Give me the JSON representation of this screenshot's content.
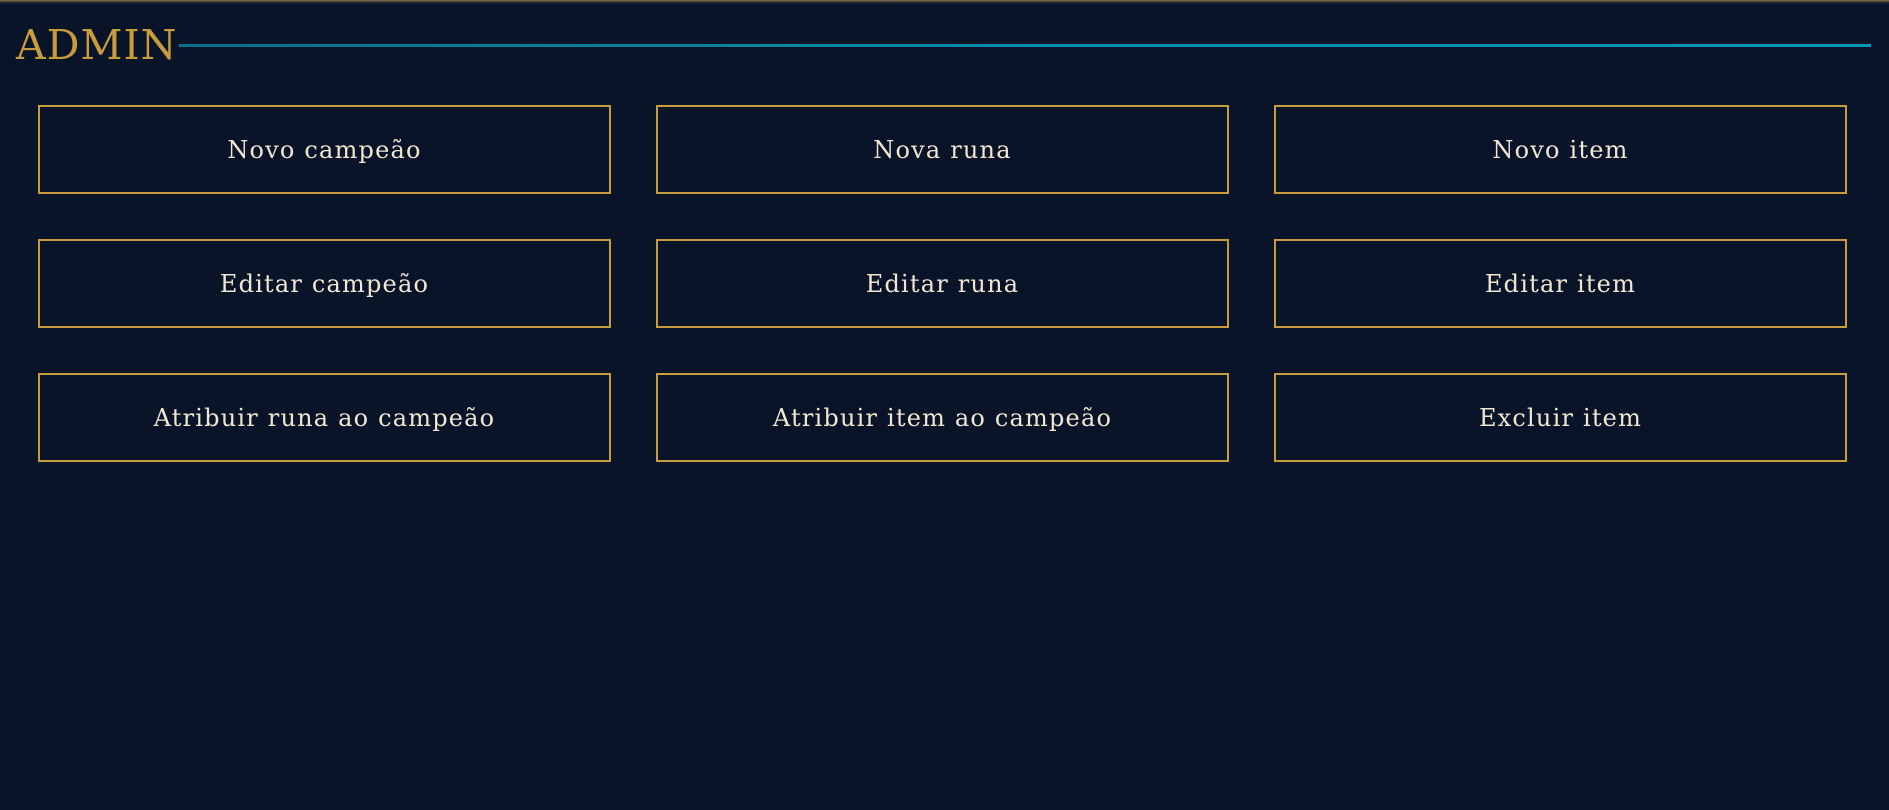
{
  "header": {
    "title": "ADMIN"
  },
  "colors": {
    "background": "#091428",
    "accent_gold": "#c89b3c",
    "rule_teal": "#0a8dab",
    "button_text": "#f0e6d2"
  },
  "buttons": [
    {
      "label": "Novo campeão"
    },
    {
      "label": "Nova runa"
    },
    {
      "label": "Novo item"
    },
    {
      "label": "Editar campeão"
    },
    {
      "label": "Editar runa"
    },
    {
      "label": "Editar item"
    },
    {
      "label": "Atribuir runa ao campeão"
    },
    {
      "label": "Atribuir item ao campeão"
    },
    {
      "label": "Excluir item"
    }
  ]
}
